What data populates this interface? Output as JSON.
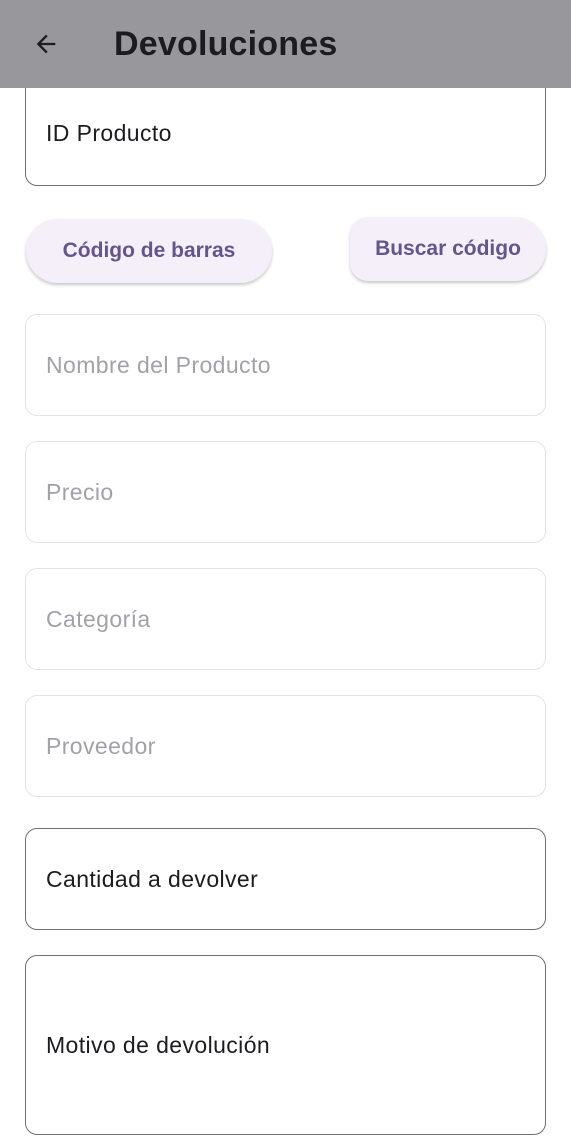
{
  "app_bar": {
    "back_icon": "arrow-left-icon",
    "title": "Devoluciones"
  },
  "form": {
    "id_producto": {
      "label": "ID Producto"
    },
    "barcode_button": "Código de barras",
    "search_button": "Buscar código",
    "nombre": {
      "placeholder": "Nombre del Producto"
    },
    "precio": {
      "placeholder": "Precio"
    },
    "categoria": {
      "placeholder": "Categoría"
    },
    "proveedor": {
      "placeholder": "Proveedor"
    },
    "cantidad": {
      "label": "Cantidad a devolver"
    },
    "motivo": {
      "label": "Motivo de devolución"
    }
  },
  "colors": {
    "app_bar": "#98979c",
    "button_bg": "#f4eff8",
    "button_text": "#65558f",
    "field_border": "#6f6d74",
    "disabled_border": "#e4e2e7",
    "placeholder_text": "#a3a1a8"
  }
}
